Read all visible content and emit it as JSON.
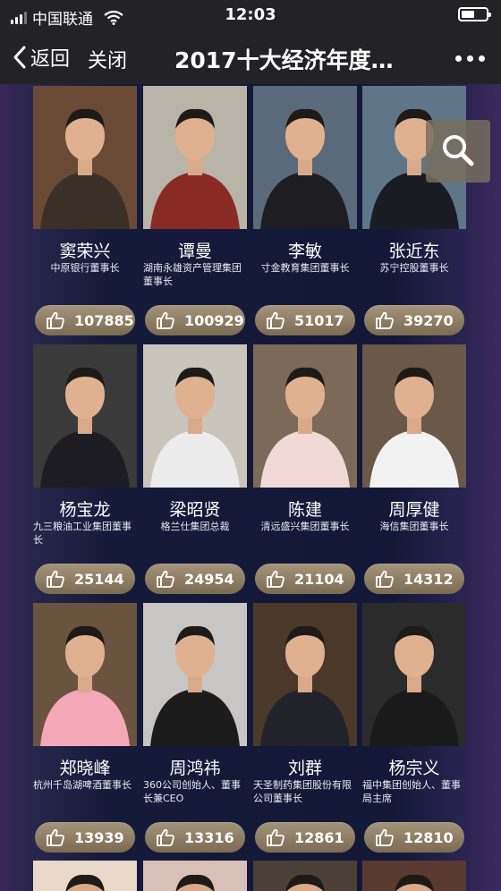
{
  "status": {
    "carrier": "中国联通",
    "time": "12:03"
  },
  "nav": {
    "back_label": "返回",
    "close_label": "关闭",
    "title": "2017十大经济年度…"
  },
  "icons": {
    "back": "chevron-left-icon",
    "more": "more-dots-icon",
    "zoom": "magnifier-icon",
    "vote": "thumbs-up-icon"
  },
  "colors": {
    "bar_bg": "#232326",
    "page_bg": "#141838",
    "vote_button": "#8e7f64"
  },
  "people": [
    {
      "name": "窦荣兴",
      "title": "中原银行董事长",
      "votes": "107885"
    },
    {
      "name": "谭曼",
      "title": "湖南永雄资产管理集团董事长",
      "votes": "100929"
    },
    {
      "name": "李敏",
      "title": "寸金教育集团董事长",
      "votes": "51017"
    },
    {
      "name": "张近东",
      "title": "苏宁控股董事长",
      "votes": "39270"
    },
    {
      "name": "杨宝龙",
      "title": "九三粮油工业集团董事长",
      "votes": "25144"
    },
    {
      "name": "梁昭贤",
      "title": "格兰仕集团总裁",
      "votes": "24954"
    },
    {
      "name": "陈建",
      "title": "清远盛兴集团董事长",
      "votes": "21104"
    },
    {
      "name": "周厚健",
      "title": "海信集团董事长",
      "votes": "14312"
    },
    {
      "name": "郑晓峰",
      "title": "杭州千岛湖啤酒董事长",
      "votes": "13939"
    },
    {
      "name": "周鸿祎",
      "title": "360公司创始人、董事长兼CEO",
      "votes": "13316"
    },
    {
      "name": "刘群",
      "title": "天圣制药集团股份有限公司董事长",
      "votes": "12861"
    },
    {
      "name": "杨宗义",
      "title": "福中集团创始人、董事局主席",
      "votes": "12810"
    }
  ]
}
